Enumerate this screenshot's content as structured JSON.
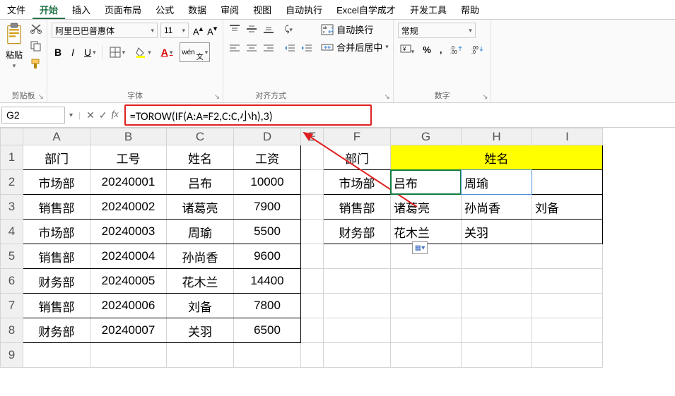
{
  "menu": [
    "文件",
    "开始",
    "插入",
    "页面布局",
    "公式",
    "数据",
    "审阅",
    "视图",
    "自动执行",
    "Excel自学成才",
    "开发工具",
    "帮助"
  ],
  "active_menu": 1,
  "ribbon": {
    "clipboard": {
      "paste": "粘贴",
      "label": "剪贴板"
    },
    "font": {
      "name": "阿里巴巴普惠体",
      "size": "11",
      "bold": "B",
      "italic": "I",
      "underline": "U",
      "wen": "wén",
      "label": "字体"
    },
    "align": {
      "wrap": "自动换行",
      "merge": "合并后居中",
      "label": "对齐方式"
    },
    "number": {
      "format": "常规",
      "label": "数字"
    }
  },
  "namebox": "G2",
  "formula": "=TOROW(IF(A:A=F2,C:C,小h),3)",
  "columns": [
    "A",
    "B",
    "C",
    "D",
    "E",
    "F",
    "G",
    "H",
    "I"
  ],
  "rows": [
    "1",
    "2",
    "3",
    "4",
    "5",
    "6",
    "7",
    "8",
    "9"
  ],
  "left": {
    "headers": [
      "部门",
      "工号",
      "姓名",
      "工资"
    ],
    "data": [
      [
        "市场部",
        "20240001",
        "吕布",
        "10000"
      ],
      [
        "销售部",
        "20240002",
        "诸葛亮",
        "7900"
      ],
      [
        "市场部",
        "20240003",
        "周瑜",
        "5500"
      ],
      [
        "销售部",
        "20240004",
        "孙尚香",
        "9600"
      ],
      [
        "财务部",
        "20240005",
        "花木兰",
        "14400"
      ],
      [
        "销售部",
        "20240006",
        "刘备",
        "7800"
      ],
      [
        "财务部",
        "20240007",
        "关羽",
        "6500"
      ]
    ]
  },
  "right": {
    "h1": "部门",
    "h2": "姓名",
    "data": [
      [
        "市场部",
        "吕布",
        "周瑜",
        ""
      ],
      [
        "销售部",
        "诸葛亮",
        "孙尚香",
        "刘备"
      ],
      [
        "财务部",
        "花木兰",
        "关羽",
        ""
      ]
    ]
  }
}
